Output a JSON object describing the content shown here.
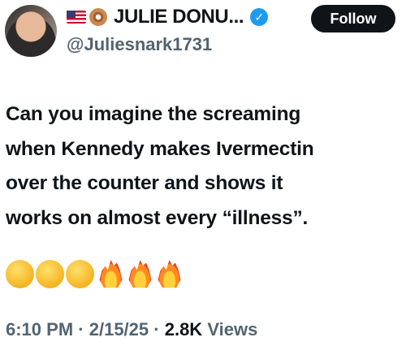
{
  "author": {
    "display_name": "JULIE DONU...",
    "handle": "@Juliesnark1731",
    "avatar_icon": "profile-photo",
    "name_icons": [
      "us-flag-icon",
      "donut-icon"
    ],
    "verified_icon": "verified-badge-icon",
    "verified_color": "#1d9bf0"
  },
  "follow_button": {
    "label": "Follow"
  },
  "tweet": {
    "text": "Can you imagine the screaming\nwhen Kennedy makes Ivermectin\nover the counter and shows it\nworks on almost every “illness”.",
    "reaction_emojis": [
      "hand-over-mouth-face-icon",
      "tears-of-joy-face-icon",
      "crying-face-icon",
      "fire-icon",
      "fire-icon",
      "fire-icon"
    ]
  },
  "meta": {
    "time": "6:10 PM",
    "date": "2/15/25",
    "views_count": "2.8K",
    "views_label": "Views",
    "separator": "·"
  }
}
